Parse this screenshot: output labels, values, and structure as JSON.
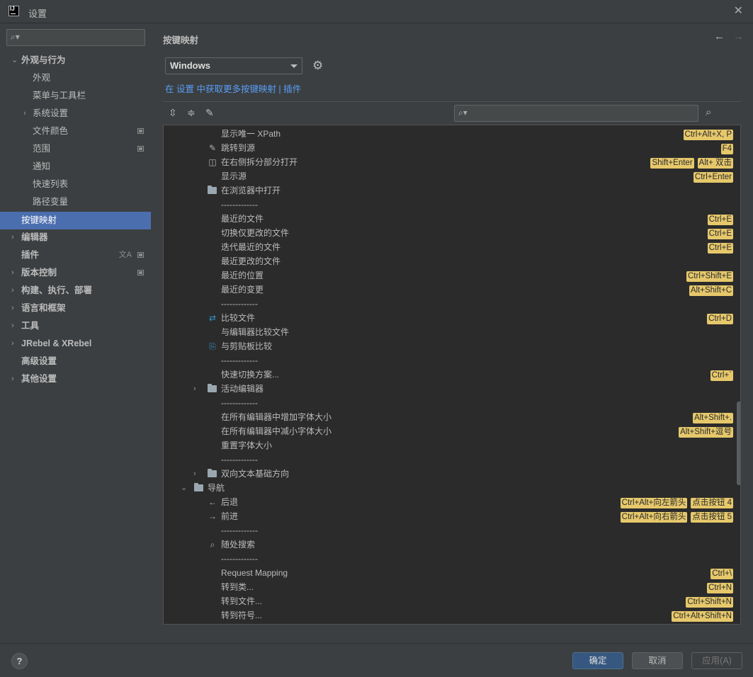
{
  "window": {
    "title": "设置"
  },
  "sidebar": {
    "search_placeholder": "",
    "items": [
      {
        "label": "外观与行为",
        "expanded": true
      },
      {
        "label": "外观"
      },
      {
        "label": "菜单与工具栏"
      },
      {
        "label": "系统设置"
      },
      {
        "label": "文件颜色"
      },
      {
        "label": "范围"
      },
      {
        "label": "通知"
      },
      {
        "label": "快速列表"
      },
      {
        "label": "路径变量"
      },
      {
        "label": "按键映射",
        "selected": true
      },
      {
        "label": "编辑器"
      },
      {
        "label": "插件"
      },
      {
        "label": "版本控制"
      },
      {
        "label": "构建、执行、部署"
      },
      {
        "label": "语言和框架"
      },
      {
        "label": "工具"
      },
      {
        "label": "JRebel & XRebel"
      },
      {
        "label": "高级设置"
      },
      {
        "label": "其他设置"
      }
    ]
  },
  "main": {
    "title": "按键映射",
    "keymap": "Windows",
    "link_text": "在 设置 中获取更多按键映射 | 插件",
    "search_placeholder": ""
  },
  "tree": {
    "rows": [
      {
        "label": "显示唯一 XPath",
        "icon": "",
        "shortcuts": [
          "Ctrl+Alt+X, P"
        ]
      },
      {
        "label": "跳转到源",
        "icon": "pencil-icon",
        "shortcuts": [
          "F4"
        ]
      },
      {
        "label": "在右侧拆分部分打开",
        "icon": "split-icon",
        "shortcuts": [
          "Shift+Enter",
          "Alt+ 双击"
        ]
      },
      {
        "label": "显示源",
        "icon": "",
        "shortcuts": [
          "Ctrl+Enter"
        ]
      },
      {
        "label": "在浏览器中打开",
        "icon": "folder-icon",
        "shortcuts": []
      },
      {
        "label": "-------------",
        "icon": "",
        "shortcuts": []
      },
      {
        "label": "最近的文件",
        "icon": "",
        "shortcuts": [
          "Ctrl+E"
        ]
      },
      {
        "label": "切换仅更改的文件",
        "icon": "",
        "shortcuts": [
          "Ctrl+E"
        ]
      },
      {
        "label": "迭代最近的文件",
        "icon": "",
        "shortcuts": [
          "Ctrl+E"
        ]
      },
      {
        "label": "最近更改的文件",
        "icon": "",
        "shortcuts": []
      },
      {
        "label": "最近的位置",
        "icon": "",
        "shortcuts": [
          "Ctrl+Shift+E"
        ]
      },
      {
        "label": "最近的变更",
        "icon": "",
        "shortcuts": [
          "Alt+Shift+C"
        ]
      },
      {
        "label": "-------------",
        "icon": "",
        "shortcuts": []
      },
      {
        "label": "比较文件",
        "icon": "diff-icon",
        "shortcuts": [
          "Ctrl+D"
        ]
      },
      {
        "label": "与编辑器比较文件",
        "icon": "",
        "shortcuts": []
      },
      {
        "label": "与剪贴板比较",
        "icon": "clipboard-diff-icon",
        "shortcuts": []
      },
      {
        "label": "-------------",
        "icon": "",
        "shortcuts": []
      },
      {
        "label": "快速切换方案...",
        "icon": "",
        "shortcuts": [
          "Ctrl+`"
        ]
      },
      {
        "label": "活动编辑器",
        "icon": "folder-icon",
        "expander": "collapsed",
        "shortcuts": []
      },
      {
        "label": "-------------",
        "icon": "",
        "shortcuts": []
      },
      {
        "label": "在所有编辑器中增加字体大小",
        "icon": "",
        "shortcuts": [
          "Alt+Shift+."
        ]
      },
      {
        "label": "在所有编辑器中减小字体大小",
        "icon": "",
        "shortcuts": [
          "Alt+Shift+逗号"
        ]
      },
      {
        "label": "重置字体大小",
        "icon": "",
        "shortcuts": []
      },
      {
        "label": "-------------",
        "icon": "",
        "shortcuts": []
      },
      {
        "label": "双向文本基础方向",
        "icon": "folder-icon",
        "expander": "collapsed",
        "shortcuts": []
      },
      {
        "label": "导航",
        "icon": "folder-icon",
        "expander": "expanded",
        "level": 0,
        "shortcuts": []
      },
      {
        "label": "后退",
        "icon": "arrow-left-icon",
        "shortcuts": [
          "Ctrl+Alt+向左箭头",
          "点击按钮 4"
        ]
      },
      {
        "label": "前进",
        "icon": "arrow-right-icon",
        "shortcuts": [
          "Ctrl+Alt+向右箭头",
          "点击按钮 5"
        ]
      },
      {
        "label": "-------------",
        "icon": "",
        "shortcuts": []
      },
      {
        "label": "随处搜索",
        "icon": "search-icon",
        "shortcuts": []
      },
      {
        "label": "-------------",
        "icon": "",
        "shortcuts": []
      },
      {
        "label": "Request Mapping",
        "icon": "",
        "shortcuts": [
          "Ctrl+\\"
        ]
      },
      {
        "label": "转到类...",
        "icon": "",
        "shortcuts": [
          "Ctrl+N"
        ]
      },
      {
        "label": "转到文件...",
        "icon": "",
        "shortcuts": [
          "Ctrl+Shift+N"
        ]
      },
      {
        "label": "转到符号...",
        "icon": "",
        "shortcuts": [
          "Ctrl+Alt+Shift+N"
        ]
      }
    ]
  },
  "footer": {
    "help": "?",
    "ok": "确定",
    "cancel": "取消",
    "apply": "应用(A)"
  },
  "colors": {
    "accent": "#4b6eaf",
    "link": "#589df6",
    "shortcut_bg": "#e6c86b",
    "panel_bg": "#3c3f41",
    "tree_bg": "#2b2b2b"
  }
}
